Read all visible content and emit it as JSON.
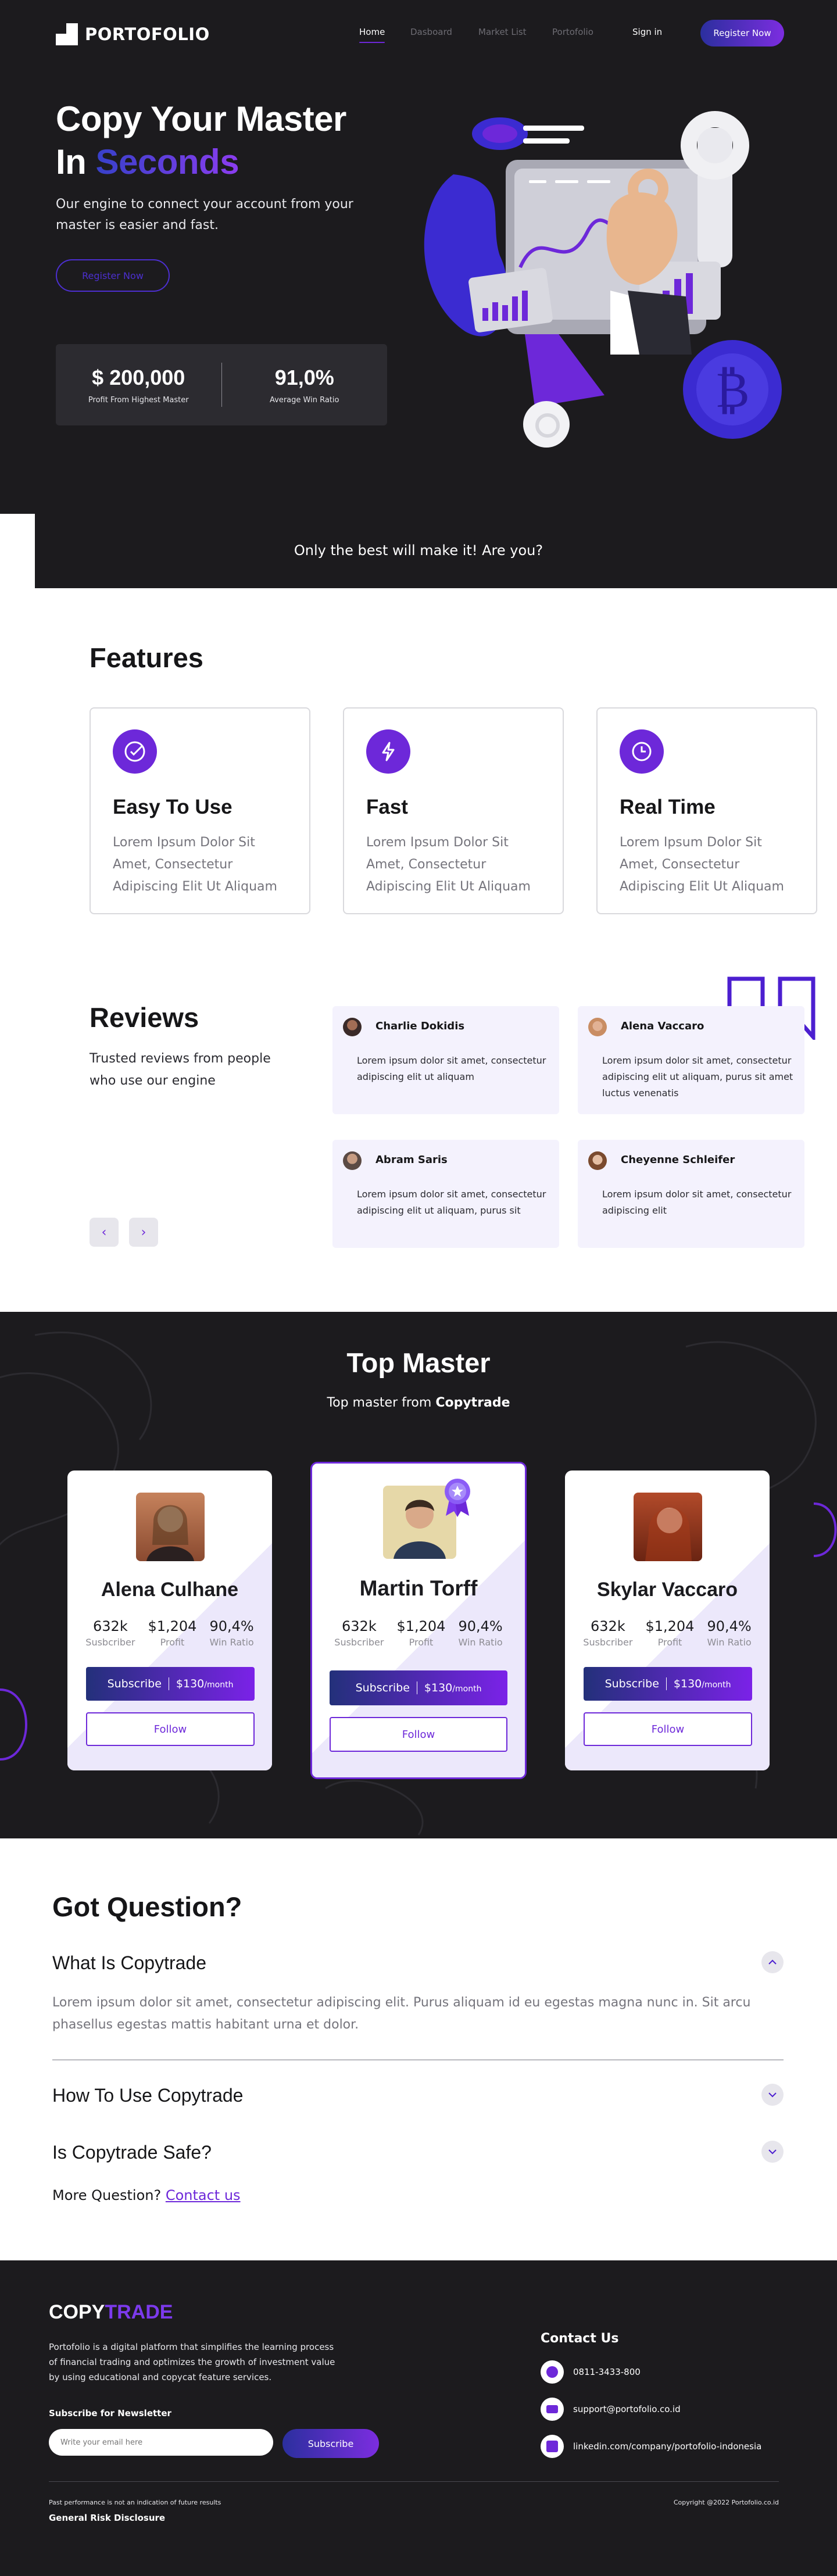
{
  "nav": {
    "logo_text": "PORTOFOLIO",
    "links": [
      "Home",
      "Dasboard",
      "Market List",
      "Portofolio"
    ],
    "signin": "Sign in",
    "register": "Register Now"
  },
  "hero": {
    "title_line1": "Copy Your Master",
    "title_line2_a": "In ",
    "title_line2_b": "Seconds",
    "subtitle": "Our engine to connect your account from your master is easier and fast.",
    "cta": "Register Now",
    "stats": [
      {
        "value": "$ 200,000",
        "label": "Profit From Highest Master"
      },
      {
        "value": "91,0%",
        "label": "Average Win Ratio"
      }
    ],
    "tagline": "Only the best will make it! Are you?"
  },
  "features": {
    "title": "Features",
    "items": [
      {
        "icon": "check-circle-icon",
        "title": "Easy To Use",
        "desc": "Lorem Ipsum Dolor Sit Amet, Consectetur Adipiscing Elit Ut Aliquam"
      },
      {
        "icon": "lightning-icon",
        "title": "Fast",
        "desc": "Lorem Ipsum Dolor Sit Amet, Consectetur Adipiscing Elit Ut Aliquam"
      },
      {
        "icon": "clock-icon",
        "title": "Real Time",
        "desc": "Lorem Ipsum Dolor Sit Amet, Consectetur Adipiscing Elit Ut Aliquam"
      }
    ]
  },
  "reviews": {
    "title": "Reviews",
    "subtitle": "Trusted reviews from people who use our engine",
    "items": [
      {
        "name": "Charlie Dokidis",
        "text": "Lorem ipsum dolor sit amet, consectetur adipiscing elit ut aliquam"
      },
      {
        "name": "Alena Vaccaro",
        "text": "Lorem ipsum dolor sit amet, consectetur adipiscing elit ut aliquam, purus sit amet luctus venenatis"
      },
      {
        "name": "Abram Saris",
        "text": "Lorem ipsum dolor sit amet, consectetur adipiscing elit ut aliquam, purus sit"
      },
      {
        "name": "Cheyenne Schleifer",
        "text": "Lorem ipsum dolor sit amet, consectetur adipiscing elit"
      }
    ],
    "prev": "‹",
    "next": "›"
  },
  "master": {
    "title": "Top Master",
    "subtitle_a": "Top master from ",
    "subtitle_b": "Copytrade",
    "cards": [
      {
        "name": "Alena Culhane",
        "subscriber": "632k",
        "profit": "$1,204",
        "win": "90,4%",
        "price": "$130",
        "per": "/month",
        "subscribe": "Subscribe",
        "follow": "Follow"
      },
      {
        "name": "Martin Torff",
        "subscriber": "632k",
        "profit": "$1,204",
        "win": "90,4%",
        "price": "$130",
        "per": "/month",
        "subscribe": "Subscribe",
        "follow": "Follow"
      },
      {
        "name": "Skylar Vaccaro",
        "subscriber": "632k",
        "profit": "$1,204",
        "win": "90,4%",
        "price": "$130",
        "per": "/month",
        "subscribe": "Subscribe",
        "follow": "Follow"
      }
    ],
    "labels": {
      "subscriber": "Susbcriber",
      "profit": "Profit",
      "win": "Win Ratio"
    }
  },
  "faq": {
    "title": "Got Question?",
    "items": [
      {
        "q": "What Is Copytrade",
        "a": "Lorem ipsum dolor sit amet, consectetur adipiscing elit. Purus aliquam id eu egestas magna nunc in. Sit arcu phasellus egestas mattis habitant urna et dolor."
      },
      {
        "q": "How To Use Copytrade"
      },
      {
        "q": "Is Copytrade Safe?"
      }
    ],
    "more_text": "More Question? ",
    "more_link": "Contact us"
  },
  "footer": {
    "logo_a": "COPY",
    "logo_b": "TRADE",
    "desc": "Portofolio is a digital platform that simplifies the learning process of financial trading and optimizes the growth of investment value by using educational and copycat feature services.",
    "newsletter_label": "Subscribe for Newsletter",
    "newsletter_placeholder": "Write your email here",
    "newsletter_button": "Subscribe",
    "contact_title": "Contact Us",
    "phone": "0811-3433-800",
    "email": "support@portofolio.co.id",
    "linkedin": "linkedin.com/company/portofolio-indonesia",
    "disclaimer": "Past performance is not an indication of future results",
    "risk": "General Risk Disclosure",
    "copyright": "Copyright @2022 Portofolio.co.id"
  },
  "colors": {
    "accent": "#6d28d9",
    "dark": "#1c1b1e",
    "gradient_start": "#2b2f9e",
    "gradient_end": "#7c2de0"
  }
}
